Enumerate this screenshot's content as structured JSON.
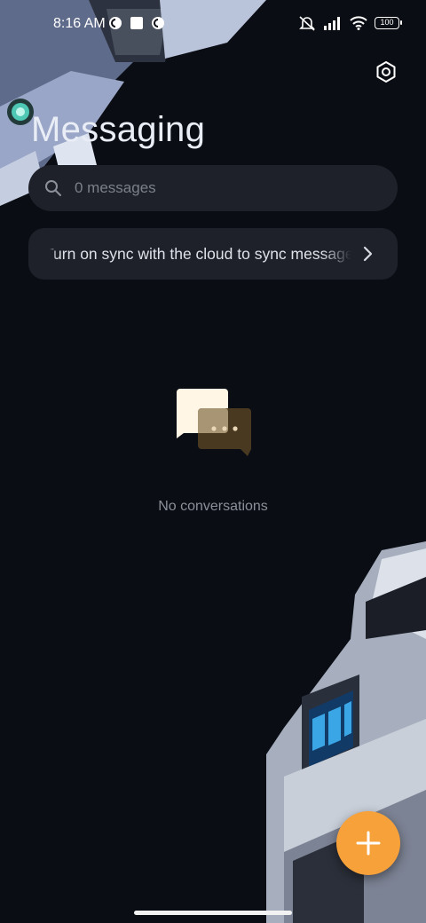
{
  "status_bar": {
    "time": "8:16 AM",
    "battery": "100",
    "icons": [
      "notification-c-icon",
      "square-notification-icon",
      "notification-c-icon",
      "mute-icon",
      "signal-icon",
      "wifi-icon",
      "battery-icon"
    ]
  },
  "header": {
    "title": "Messaging",
    "settings_icon": "hexagon-settings-icon"
  },
  "search": {
    "placeholder": "0 messages"
  },
  "sync_banner": {
    "text": "Turn on sync with the cloud to sync messages"
  },
  "empty_state": {
    "text": "No conversations",
    "illustration": "chat-bubbles-icon"
  },
  "fab": {
    "icon": "plus-icon"
  },
  "colors": {
    "background": "#0b0d14",
    "card": "#1e2129",
    "accent": "#f7a13a",
    "bubble_light": "#fff6e6",
    "bubble_dark": "#4e3d22"
  }
}
